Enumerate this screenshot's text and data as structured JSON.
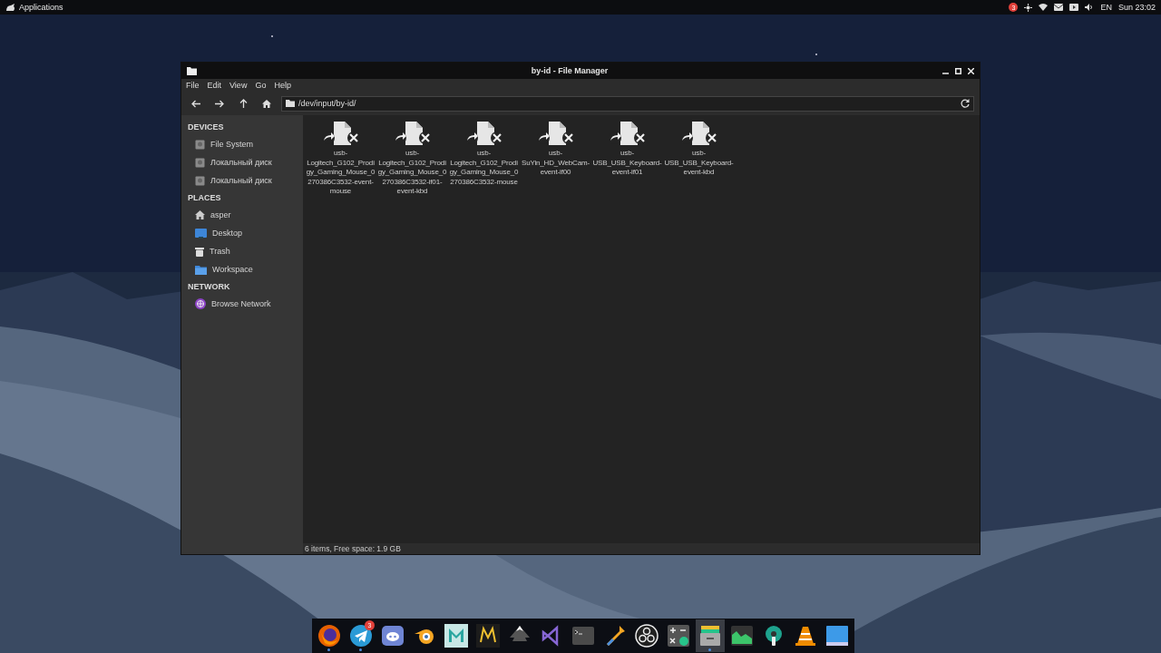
{
  "top_panel": {
    "menu_label": "Applications",
    "notification_count": "3",
    "language": "EN",
    "clock": "Sun 23:02"
  },
  "window": {
    "title": "by-id - File Manager",
    "menu": [
      "File",
      "Edit",
      "View",
      "Go",
      "Help"
    ],
    "location": "/dev/input/by-id/",
    "sidebar": [
      {
        "heading": "DEVICES",
        "items": [
          {
            "label": "File System",
            "kind": "drive"
          },
          {
            "label": "Локальный диск",
            "kind": "drive"
          },
          {
            "label": "Локальный диск",
            "kind": "drive"
          }
        ]
      },
      {
        "heading": "PLACES",
        "items": [
          {
            "label": "asper",
            "kind": "home"
          },
          {
            "label": "Desktop",
            "kind": "desktop"
          },
          {
            "label": "Trash",
            "kind": "trash"
          },
          {
            "label": "Workspace",
            "kind": "folder"
          }
        ]
      },
      {
        "heading": "NETWORK",
        "items": [
          {
            "label": "Browse Network",
            "kind": "network"
          }
        ]
      }
    ],
    "files": [
      {
        "name": "usb-Logitech_G102_Prodigy_Gaming_Mouse_0270386C3532-event-mouse"
      },
      {
        "name": "usb-Logitech_G102_Prodigy_Gaming_Mouse_0270386C3532-if01-event-kbd"
      },
      {
        "name": "usb-Logitech_G102_Prodigy_Gaming_Mouse_0270386C3532-mouse"
      },
      {
        "name": "usb-SuYin_HD_WebCam-event-if00"
      },
      {
        "name": "usb-USB_USB_Keyboard-event-if01"
      },
      {
        "name": "usb-USB_USB_Keyboard-event-kbd"
      }
    ],
    "status": "6 items, Free space: 1.9 GB"
  },
  "dock": [
    {
      "kind": "firefox",
      "running": true
    },
    {
      "kind": "telegram",
      "running": true,
      "badge": "3"
    },
    {
      "kind": "discord",
      "running": false
    },
    {
      "kind": "blender",
      "running": false
    },
    {
      "kind": "maya",
      "running": false
    },
    {
      "kind": "marvelous",
      "running": false
    },
    {
      "kind": "inkscape",
      "running": false
    },
    {
      "kind": "studio",
      "running": false
    },
    {
      "kind": "terminal",
      "running": false
    },
    {
      "kind": "picker",
      "running": false
    },
    {
      "kind": "obs",
      "running": false
    },
    {
      "kind": "calculator",
      "running": false
    },
    {
      "kind": "files",
      "running": true,
      "selected": true
    },
    {
      "kind": "monitor",
      "running": false
    },
    {
      "kind": "settings",
      "running": false
    },
    {
      "kind": "vlc",
      "running": false
    },
    {
      "kind": "desktop",
      "running": false
    }
  ]
}
